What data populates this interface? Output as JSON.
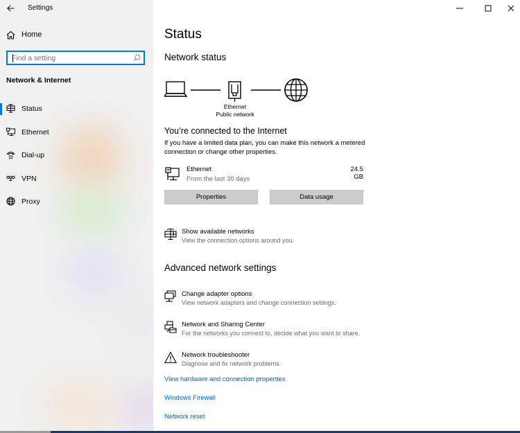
{
  "window": {
    "app_title": "Settings",
    "controls": {
      "minimize": "minimize-icon",
      "maximize": "maximize-icon",
      "close": "close-icon"
    }
  },
  "sidebar": {
    "back_icon": "arrow-left-icon",
    "home_label": "Home",
    "home_icon": "home-icon",
    "search": {
      "placeholder": "Find a setting",
      "value": "",
      "icon": "search-icon"
    },
    "section_title": "Network & Internet",
    "items": [
      {
        "label": "Status",
        "icon": "globe-monitor-icon",
        "selected": true
      },
      {
        "label": "Ethernet",
        "icon": "ethernet-icon",
        "selected": false
      },
      {
        "label": "Dial-up",
        "icon": "dialup-icon",
        "selected": false
      },
      {
        "label": "VPN",
        "icon": "vpn-icon",
        "selected": false
      },
      {
        "label": "Proxy",
        "icon": "globe-icon",
        "selected": false
      }
    ],
    "accent_color": "#0078d7"
  },
  "main": {
    "title": "Status",
    "network_status_heading": "Network status",
    "diagram": {
      "adapter_label": "Ethernet",
      "network_label": "Public network"
    },
    "connection": {
      "title": "You’re connected to the Internet",
      "description": "If you have a limited data plan, you can make this network a metered connection or change other properties.",
      "adapter_name": "Ethernet",
      "usage_period": "From the last 30 days",
      "usage_amount": "24.5 GB"
    },
    "buttons": {
      "properties": "Properties",
      "data_usage": "Data usage"
    },
    "show_networks": {
      "title": "Show available networks",
      "description": "View the connection options around you."
    },
    "advanced_heading": "Advanced network settings",
    "advanced_items": [
      {
        "title": "Change adapter options",
        "description": "View network adapters and change connection settings.",
        "icon": "adapter-icon"
      },
      {
        "title": "Network and Sharing Center",
        "description": "For the networks you connect to, decide what you want to share.",
        "icon": "sharing-center-icon"
      },
      {
        "title": "Network troubleshooter",
        "description": "Diagnose and fix network problems.",
        "icon": "warning-icon"
      }
    ],
    "links": [
      "View hardware and connection properties",
      "Windows Firewall",
      "Network reset"
    ],
    "link_color": "#0067c0"
  }
}
